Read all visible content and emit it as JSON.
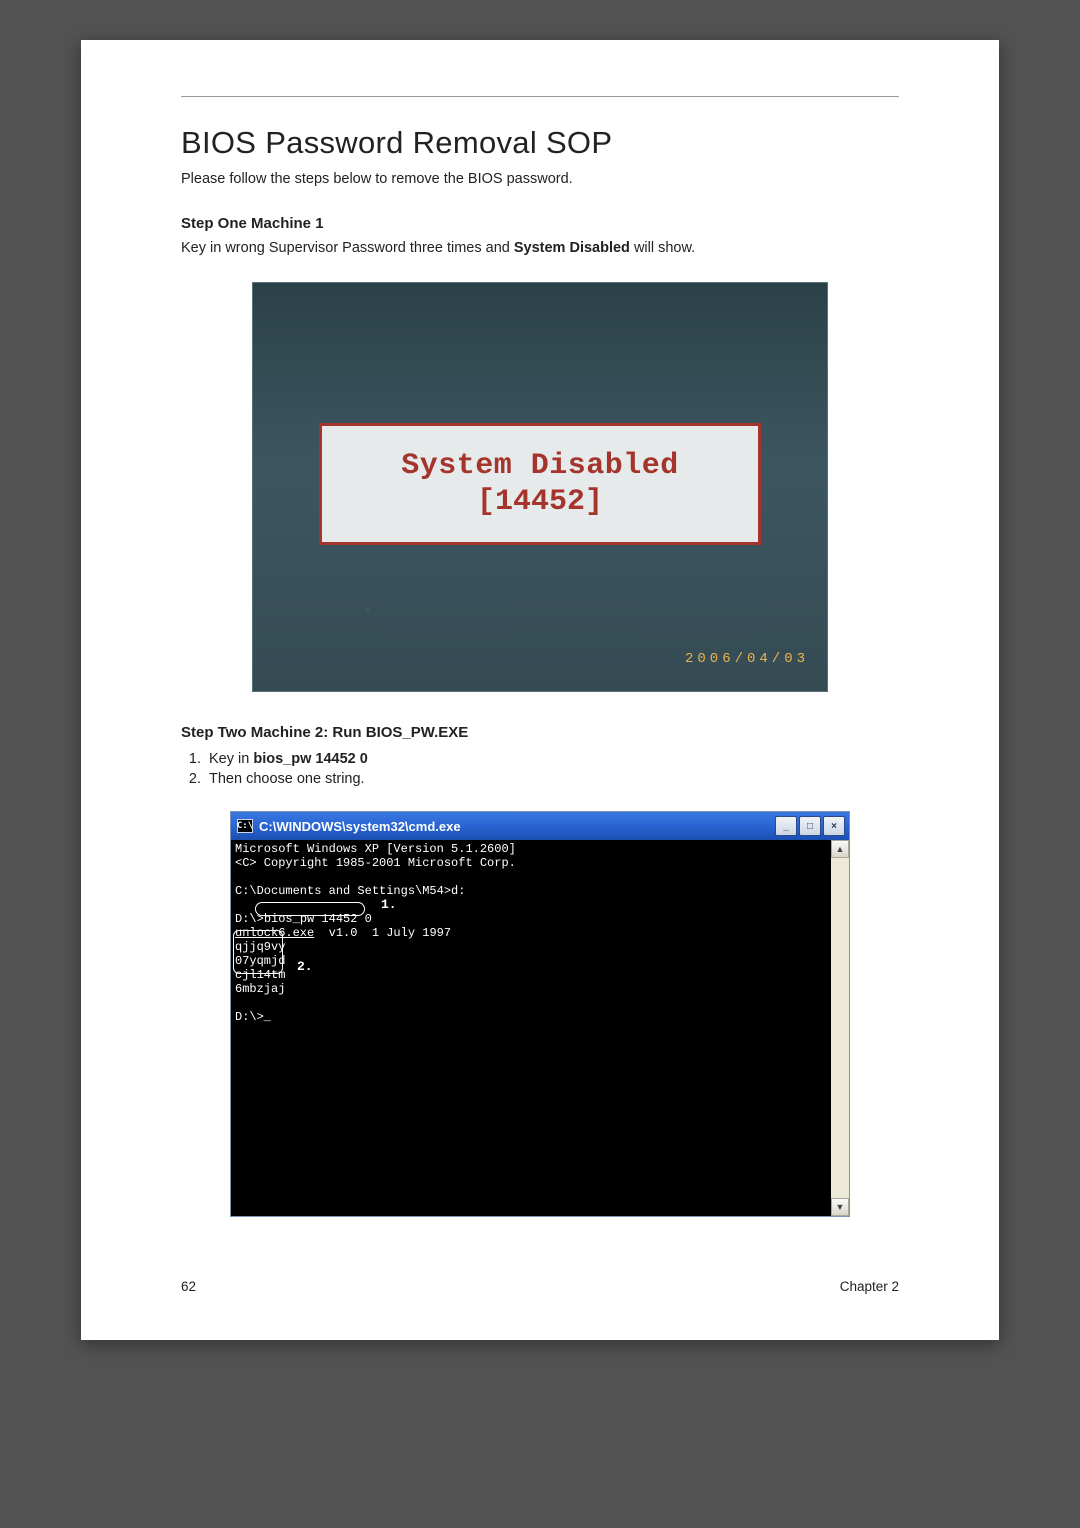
{
  "heading": "BIOS Password Removal SOP",
  "intro": "Please follow the steps below to remove the BIOS password.",
  "step1": {
    "title": "Step One Machine 1",
    "text_before": "Key in wrong Supervisor Password three times and ",
    "strong": "System Disabled",
    "text_after": " will show."
  },
  "shot1": {
    "line1": "System Disabled",
    "line2": "[14452]",
    "date": "2006/04/03"
  },
  "step2": {
    "title": "Step Two Machine 2: Run BIOS_PW.EXE",
    "items": [
      {
        "pre": "Key in ",
        "bold": "bios_pw 14452 0"
      },
      {
        "pre": "Then choose one string.",
        "bold": ""
      }
    ]
  },
  "cmd": {
    "title": "C:\\WINDOWS\\system32\\cmd.exe",
    "icon_label": "C:\\",
    "lines": {
      "l1": "Microsoft Windows XP [Version 5.1.2600]",
      "l2": "<C> Copyright 1985-2001 Microsoft Corp.",
      "l3": "",
      "l4": "C:\\Documents and Settings\\M54>d:",
      "l5": "",
      "l6a": "D:\\>",
      "l6b": "bios_pw 14452 0",
      "l7a": "unlock6.exe",
      "l7b": "  v1.0  1 July 1997",
      "l8": "qjjq9vy",
      "l9": "07yqmjd",
      "l10": "cjl14tm",
      "l11": "6mbzjaj",
      "l12": "",
      "l13": "D:\\>_"
    },
    "callout1": "1.",
    "callout2": "2.",
    "btn_min": "_",
    "btn_max": "□",
    "btn_close": "×",
    "scroll_up": "▲",
    "scroll_down": "▼"
  },
  "footer": {
    "page": "62",
    "chapter": "Chapter 2"
  }
}
